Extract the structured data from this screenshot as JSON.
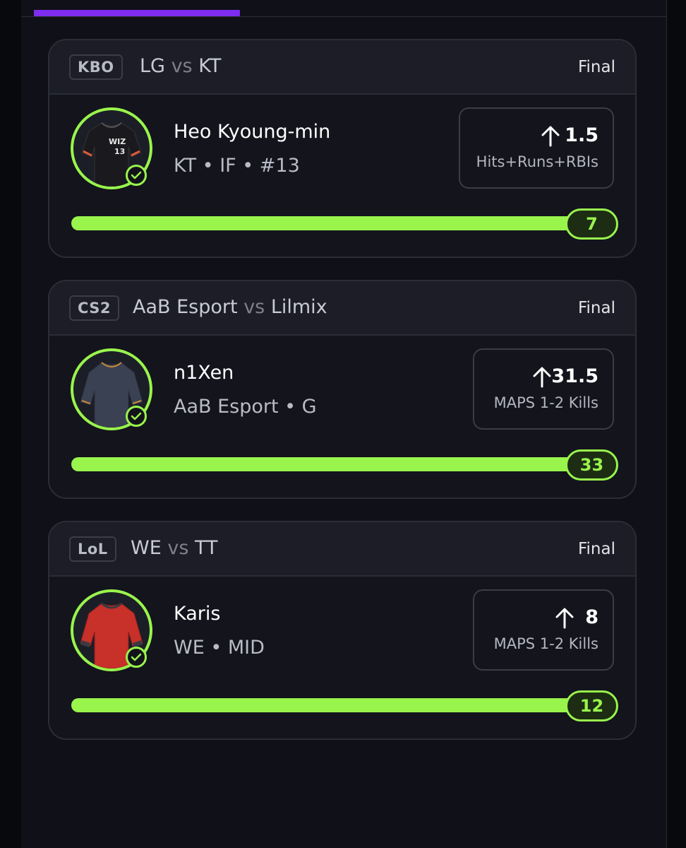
{
  "colors": {
    "accent_green": "#99f44c",
    "tab_indicator": "#7d2cf0",
    "background": "#101118"
  },
  "picks": [
    {
      "league": "KBO",
      "team_a": "LG",
      "vs": "vs",
      "team_b": "KT",
      "status": "Final",
      "player_name": "Heo Kyoung-min",
      "player_meta": "KT • IF • #13",
      "direction_icon": "arrow-up-icon",
      "line": "1.5",
      "stat": "Hits+Runs+RBIs",
      "actual": "7",
      "progress": 1.0,
      "jersey": {
        "color": "#1a1a1e",
        "trim": "#e35a3c",
        "text": "WIZ",
        "number": "13"
      }
    },
    {
      "league": "CS2",
      "team_a": "AaB Esport",
      "vs": "vs",
      "team_b": "Lilmix",
      "status": "Final",
      "player_name": "n1Xen",
      "player_meta": "AaB Esport • G",
      "direction_icon": "arrow-up-icon",
      "line": "31.5",
      "stat": "MAPS 1-2 Kills",
      "actual": "33",
      "progress": 1.0,
      "jersey": {
        "color": "#3a4152",
        "trim": "#c98a3a"
      }
    },
    {
      "league": "LoL",
      "team_a": "WE",
      "vs": "vs",
      "team_b": "TT",
      "status": "Final",
      "player_name": "Karis",
      "player_meta": "WE • MID",
      "direction_icon": "arrow-up-icon",
      "line": "8",
      "stat": "MAPS 1-2 Kills",
      "actual": "12",
      "progress": 1.0,
      "jersey": {
        "color": "#c8302a",
        "trim": "#3a3a40"
      }
    }
  ]
}
